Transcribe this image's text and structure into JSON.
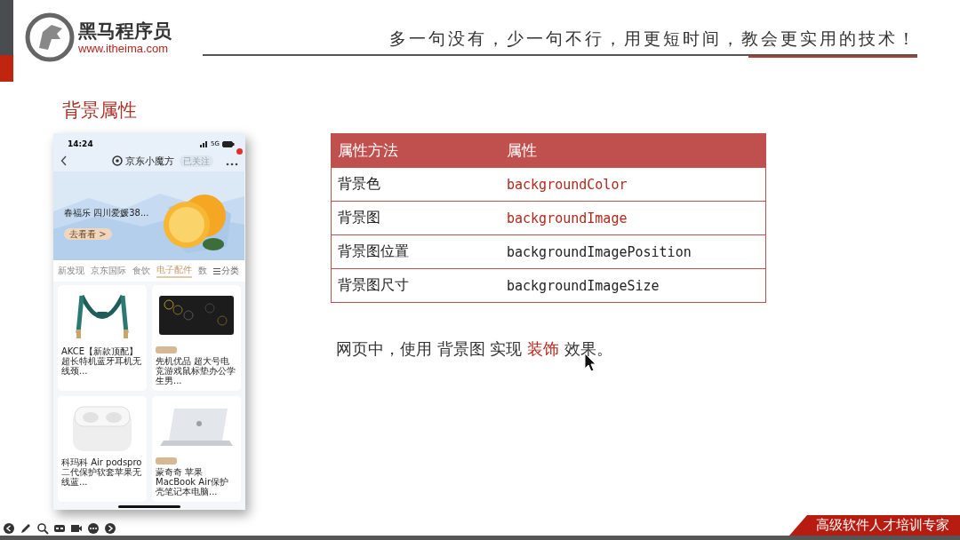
{
  "header": {
    "brand": "黑马程序员",
    "url": "www.itheima.com",
    "slogan": "多一句没有，少一句不行，用更短时间，教会更实用的技术！"
  },
  "title": "背景属性",
  "phone": {
    "time": "14:24",
    "network": "5G",
    "store": "京东小魔方",
    "follow": "已关注",
    "banner": {
      "text": "春福乐 四川爱媛38...",
      "button": "去看看 >"
    },
    "tabs": [
      {
        "label": "新发现",
        "selected": false
      },
      {
        "label": "京东国际",
        "selected": false
      },
      {
        "label": "食饮",
        "selected": false
      },
      {
        "label": "电子配件",
        "selected": true
      },
      {
        "label": "数",
        "selected": false
      }
    ],
    "category": "分类",
    "products": [
      {
        "title": "AKCE【新款顶配】超长特机蓝牙耳机无线颈...",
        "tagged": false,
        "kind": "earphones"
      },
      {
        "title": "先机优品 超大号电竞游戏鼠标垫办公学生男...",
        "tagged": true,
        "kind": "mousepad"
      },
      {
        "title": "科玛科 Air podspro二代保护软套苹果无线蓝...",
        "tagged": false,
        "kind": "case"
      },
      {
        "title": "蒙奇奇 苹果MacBook Air保护壳笔记本电脑...",
        "tagged": true,
        "kind": "laptop"
      }
    ]
  },
  "table": {
    "columns": [
      "属性方法",
      "属性"
    ],
    "rows": [
      {
        "method": "背景色",
        "property": "backgroundColor",
        "highlight": true
      },
      {
        "method": "背景图",
        "property": "backgroundImage",
        "highlight": true
      },
      {
        "method": "背景图位置",
        "property": "backgroundImagePosition",
        "highlight": false
      },
      {
        "method": "背景图尺寸",
        "property": "backgroundImageSize",
        "highlight": false
      }
    ]
  },
  "note": "网页中，使用 背景图 实现 **装饰** 效果。",
  "footer": {
    "banner": "高级软件人才培训专家"
  }
}
